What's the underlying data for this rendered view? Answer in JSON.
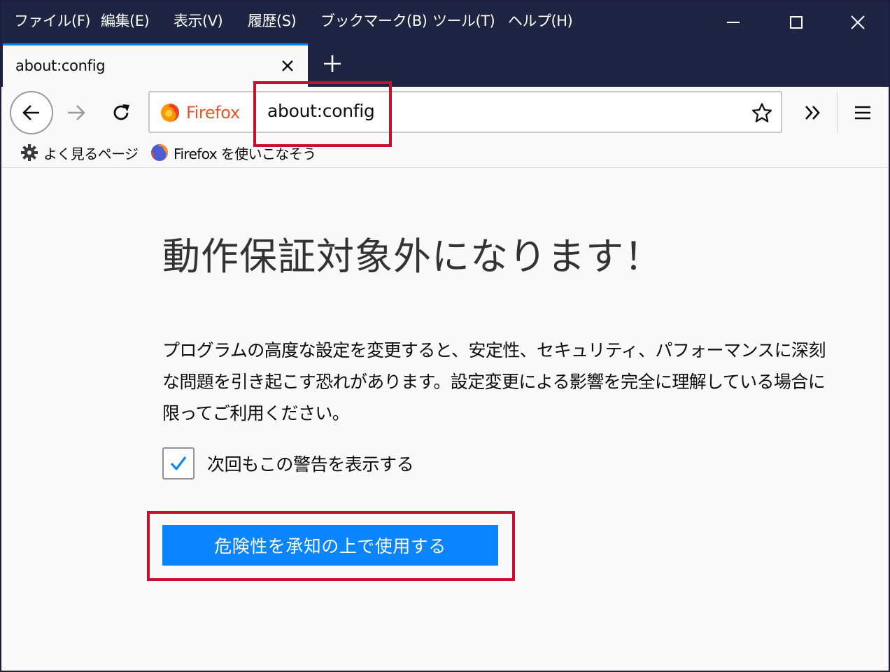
{
  "menubar": {
    "items": [
      "ファイル(F)",
      "編集(E)",
      "表示(V)",
      "履歴(S)",
      "ブックマーク(B)",
      "ツール(T)",
      "ヘルプ(H)"
    ]
  },
  "window_controls": {
    "icons": [
      "minimize-icon",
      "maximize-icon",
      "close-icon"
    ]
  },
  "tab": {
    "title": "about:config"
  },
  "urlbar": {
    "identity_label": "Firefox",
    "url": "about:config"
  },
  "bookmarks": [
    {
      "label": "よく見るページ",
      "icon": "gear-icon"
    },
    {
      "label": "Firefox を使いこなそう",
      "icon": "firefox-icon"
    }
  ],
  "warning": {
    "title": "動作保証対象外になります！",
    "body": "プログラムの高度な設定を変更すると、安定性、セキュリティ、パフォーマンスに深刻な問題を引き起こす恐れがあります。設定変更による影響を完全に理解している場合に限ってご利用ください。",
    "checkbox_label": "次回もこの警告を表示する",
    "checkbox_checked": true,
    "accept_button": "危険性を承知の上で使用する"
  },
  "colors": {
    "accent": "#0a84ff",
    "titlebar": "#1f2442",
    "highlight": "#c8102e",
    "firefox_label": "#e8552a"
  }
}
